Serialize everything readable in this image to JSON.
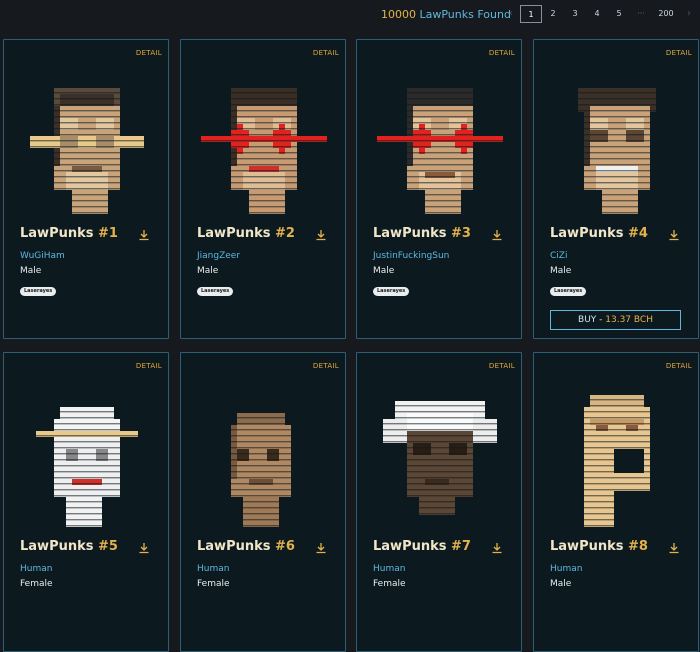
{
  "header": {
    "count": "10000",
    "found_label": " LawPunks Found",
    "pages": [
      "1",
      "2",
      "3",
      "4",
      "5",
      "···",
      "200"
    ],
    "prev_icon": "chevron-left-icon",
    "next_icon": "chevron-right-icon"
  },
  "cards": [
    {
      "detail": "DETAIL",
      "name": "LawPunks ",
      "id": "#1",
      "line1": "WuGiHam",
      "line2": "Male",
      "badge": "Laserayes"
    },
    {
      "detail": "DETAIL",
      "name": "LawPunks ",
      "id": "#2",
      "line1": "JiangZeer",
      "line2": "Male",
      "badge": "Laserayes"
    },
    {
      "detail": "DETAIL",
      "name": "LawPunks ",
      "id": "#3",
      "line1": "JustinFuckingSun",
      "line2": "Male",
      "badge": "Laserayes"
    },
    {
      "detail": "DETAIL",
      "name": "LawPunks ",
      "id": "#4",
      "line1": "CiZi",
      "line2": "Male",
      "badge": "Laserayes",
      "buy_label": "BUY - ",
      "buy_price": "13.37 BCH"
    },
    {
      "detail": "DETAIL",
      "name": "LawPunks ",
      "id": "#5",
      "line1": "Human",
      "line2": "Female"
    },
    {
      "detail": "DETAIL",
      "name": "LawPunks ",
      "id": "#6",
      "line1": "Human",
      "line2": "Female"
    },
    {
      "detail": "DETAIL",
      "name": "LawPunks ",
      "id": "#7",
      "line1": "Human",
      "line2": "Female"
    },
    {
      "detail": "DETAIL",
      "name": "LawPunks ",
      "id": "#8",
      "line1": "Human",
      "line2": "Male"
    }
  ],
  "colors": {
    "accent_blue": "#5fb7dd",
    "accent_gold": "#e4b24a",
    "card_border": "#2b5f76",
    "background": "#161a1f",
    "laser_red": "#e0231e"
  },
  "icons": {
    "download": "download-icon"
  }
}
